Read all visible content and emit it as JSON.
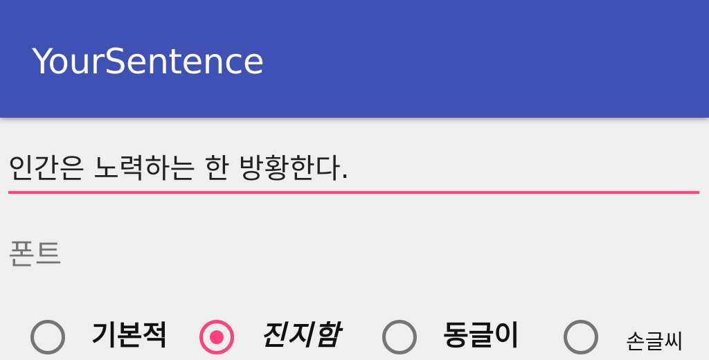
{
  "app_bar": {
    "title": "YourSentence",
    "color": "#3f51b5"
  },
  "sentence_input": {
    "value": "인간은 노력하는 한 방황한다.",
    "underline_color": "#ff4081"
  },
  "font_section": {
    "label": "폰트",
    "selected": "진지함",
    "options": [
      {
        "label": "기본적",
        "checked": false
      },
      {
        "label": "진지함",
        "checked": true
      },
      {
        "label": "동글이",
        "checked": false
      },
      {
        "label": "손글씨",
        "checked": false
      }
    ]
  },
  "accent_color": "#ff4081"
}
